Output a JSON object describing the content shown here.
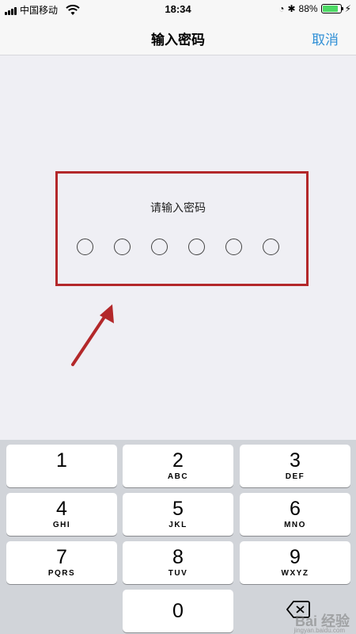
{
  "status_bar": {
    "carrier": "中国移动",
    "time": "18:34",
    "battery_percent": "88%",
    "battery_level": 0.88
  },
  "nav": {
    "title": "输入密码",
    "cancel_label": "取消"
  },
  "password": {
    "prompt": "请输入密码",
    "digit_count": 6
  },
  "keypad": {
    "keys": [
      {
        "num": "1",
        "letters": ""
      },
      {
        "num": "2",
        "letters": "ABC"
      },
      {
        "num": "3",
        "letters": "DEF"
      },
      {
        "num": "4",
        "letters": "GHI"
      },
      {
        "num": "5",
        "letters": "JKL"
      },
      {
        "num": "6",
        "letters": "MNO"
      },
      {
        "num": "7",
        "letters": "PQRS"
      },
      {
        "num": "8",
        "letters": "TUV"
      },
      {
        "num": "9",
        "letters": "WXYZ"
      },
      {
        "num": "0",
        "letters": ""
      }
    ],
    "delete_icon": "backspace-icon"
  },
  "watermark": {
    "text": "Bai 经验",
    "url": "jingyan.baidu.com"
  },
  "colors": {
    "accent": "#2f8fd6",
    "highlight": "#b3282a"
  }
}
